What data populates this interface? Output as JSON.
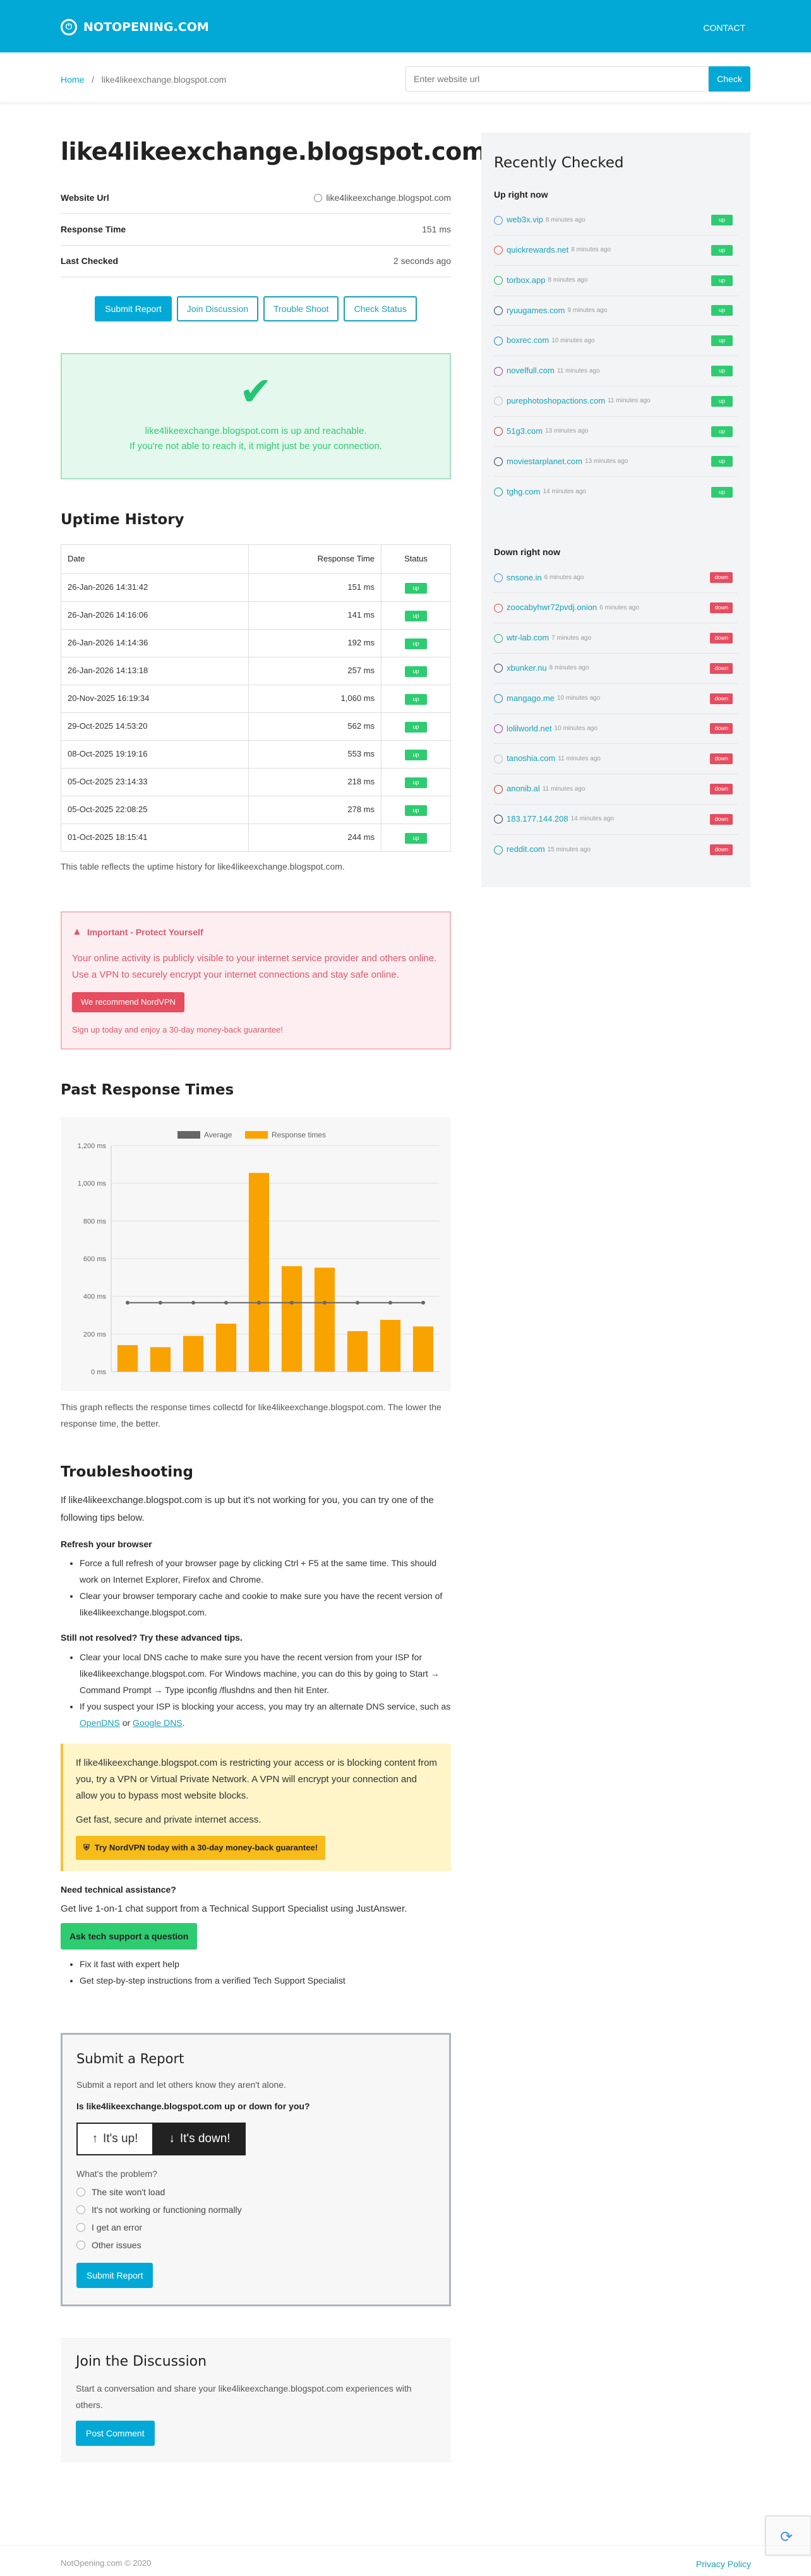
{
  "nav": {
    "brand": "NOTOPENING.COM",
    "contact": "CONTACT"
  },
  "breadcrumb": {
    "home": "Home",
    "sep": "/",
    "current": "like4likeexchange.blogspot.com"
  },
  "search": {
    "placeholder": "Enter website url",
    "button": "Check"
  },
  "main": {
    "title": "like4likeexchange.blogspot.com",
    "website_url_label": "Website Url",
    "website_url_value": "like4likeexchange.blogspot.com",
    "response_time_label": "Response Time",
    "response_time_value": "151 ms",
    "last_checked_label": "Last Checked",
    "last_checked_value": "2 seconds ago",
    "buttons": [
      "Submit Report",
      "Join Discussion",
      "Trouble Shoot",
      "Check Status"
    ],
    "status_line1": "like4likeexchange.blogspot.com is up and reachable.",
    "status_line2": "If you're not able to reach it, it might just be your connection."
  },
  "uptime": {
    "heading": "Uptime History",
    "headers": [
      "Date",
      "Response Time",
      "Status"
    ],
    "rows": [
      [
        "26-Jan-2026 14:31:42",
        "151 ms",
        "up"
      ],
      [
        "26-Jan-2026 14:16:06",
        "141 ms",
        "up"
      ],
      [
        "26-Jan-2026 14:14:36",
        "192 ms",
        "up"
      ],
      [
        "26-Jan-2026 14:13:18",
        "257 ms",
        "up"
      ],
      [
        "20-Nov-2025 16:19:34",
        "1,060 ms",
        "up"
      ],
      [
        "29-Oct-2025 14:53:20",
        "562 ms",
        "up"
      ],
      [
        "08-Oct-2025 19:19:16",
        "553 ms",
        "up"
      ],
      [
        "05-Oct-2025 23:14:33",
        "218 ms",
        "up"
      ],
      [
        "05-Oct-2025 22:08:25",
        "278 ms",
        "up"
      ],
      [
        "01-Oct-2025 18:15:41",
        "244 ms",
        "up"
      ]
    ],
    "note": "This table reflects the uptime history for like4likeexchange.blogspot.com."
  },
  "warning": {
    "title": "Important - Protect Yourself",
    "text": "Your online activity is publicly visible to your internet service provider and others online. Use a VPN to securely encrypt your internet connections and stay safe online.",
    "button": "We recommend NordVPN",
    "small": "Sign up today and enjoy a 30-day money-back guarantee!"
  },
  "chart_section": {
    "heading": "Past Response Times",
    "note": "This graph reflects the response times collectd for like4likeexchange.blogspot.com. The lower the response time, the better."
  },
  "chart_data": {
    "type": "bar",
    "legend": [
      "Average",
      "Response times"
    ],
    "legend_position": "top",
    "colors": {
      "bar": "#f9a300",
      "average": "#666666"
    },
    "ylim": [
      0,
      1200
    ],
    "yticks": [
      "0 ms",
      "200 ms",
      "400 ms",
      "600 ms",
      "800 ms",
      "1,000 ms",
      "1,200 ms"
    ],
    "ytick_values": [
      0,
      200,
      400,
      600,
      800,
      1000,
      1200
    ],
    "categories": [
      "",
      "",
      "",
      "",
      "",
      "",
      "",
      "",
      "",
      ""
    ],
    "series": [
      {
        "name": "Response times",
        "values": [
          141,
          130,
          190,
          255,
          1055,
          560,
          552,
          215,
          275,
          240
        ]
      },
      {
        "name": "Average",
        "values": [
          366,
          366,
          366,
          366,
          366,
          366,
          366,
          366,
          366,
          366
        ]
      }
    ],
    "grid": true
  },
  "troubleshoot": {
    "heading": "Troubleshooting",
    "intro": "If like4likeexchange.blogspot.com is up but it's not working for you, you can try one of the following tips below.",
    "refresh_h": "Refresh your browser",
    "refresh_1": "Force a full refresh of your browser page by clicking Ctrl + F5 at the same time. This should work on Internet Explorer, Firefox and Chrome.",
    "refresh_2": "Clear your browser temporary cache and cookie to make sure you have the recent version of like4likeexchange.blogspot.com.",
    "adv_h": "Still not resolved? Try these advanced tips.",
    "adv_1": "Clear your local DNS cache to make sure you have the recent version from your ISP for like4likeexchange.blogspot.com. For Windows machine, you can do this by going to Start → Command Prompt → Type ipconfig /flushdns and then hit Enter.",
    "adv_2a": "If you suspect your ISP is blocking your access, you may try an alternate DNS service, such as ",
    "opendns": "OpenDNS",
    "or": " or ",
    "googledns": "Google DNS",
    "dot": ".",
    "yellow_text": "If like4likeexchange.blogspot.com is restricting your access or is blocking content from you, try a VPN or Virtual Private Network. A VPN will encrypt your connection and allow you to bypass most website blocks.",
    "yellow_text2": "Get fast, secure and private internet access.",
    "yellow_btn": "Try NordVPN today with a 30-day money-back guarantee!",
    "tech_h": "Need technical assistance?",
    "tech_p": "Get live 1-on-1 chat support from a Technical Support Specialist using JustAnswer.",
    "tech_btn": "Ask tech support a question",
    "tech_1": "Fix it fast with expert help",
    "tech_2": "Get step-by-step instructions from a verified Tech Support Specialist"
  },
  "report": {
    "heading": "Submit a Report",
    "sub": "Submit a report and let others know they aren't alone.",
    "question": "Is like4likeexchange.blogspot.com up or down for you?",
    "up": "It's up!",
    "down": "It's down!",
    "problem": "What's the problem?",
    "options": [
      "The site won't load",
      "It's not working or functioning normally",
      "I get an error",
      "Other issues"
    ],
    "submit": "Submit Report"
  },
  "discussion": {
    "heading": "Join the Discussion",
    "text": "Start a conversation and share your like4likeexchange.blogspot.com experiences with others.",
    "button": "Post Comment"
  },
  "sidebar": {
    "heading": "Recently Checked",
    "up_heading": "Up right now",
    "up": [
      {
        "site": "web3x.vip",
        "time": "8 minutes ago"
      },
      {
        "site": "quickrewards.net",
        "time": "8 minutes ago"
      },
      {
        "site": "torbox.app",
        "time": "8 minutes ago"
      },
      {
        "site": "ryuugames.com",
        "time": "9 minutes ago"
      },
      {
        "site": "boxrec.com",
        "time": "10 minutes ago"
      },
      {
        "site": "novelfull.com",
        "time": "11 minutes ago"
      },
      {
        "site": "purephotoshopactions.com",
        "time": "11 minutes ago"
      },
      {
        "site": "51g3.com",
        "time": "13 minutes ago"
      },
      {
        "site": "moviestarplanet.com",
        "time": "13 minutes ago"
      },
      {
        "site": "tghg.com",
        "time": "14 minutes ago"
      }
    ],
    "down_heading": "Down right now",
    "down": [
      {
        "site": "snsone.in",
        "time": "6 minutes ago"
      },
      {
        "site": "zoocabyhwr72pvdj.onion",
        "time": "6 minutes ago"
      },
      {
        "site": "wtr-lab.com",
        "time": "7 minutes ago"
      },
      {
        "site": "xbunker.nu",
        "time": "8 minutes ago"
      },
      {
        "site": "mangago.me",
        "time": "10 minutes ago"
      },
      {
        "site": "lolilworld.net",
        "time": "10 minutes ago"
      },
      {
        "site": "tanoshia.com",
        "time": "11 minutes ago"
      },
      {
        "site": "anonib.al",
        "time": "11 minutes ago"
      },
      {
        "site": "183.177.144.208",
        "time": "14 minutes ago"
      },
      {
        "site": "reddit.com",
        "time": "15 minutes ago"
      }
    ],
    "up_label": "up",
    "down_label": "down"
  },
  "footer": {
    "copy": "NotOpening.com © 2020",
    "privacy": "Privacy Policy"
  }
}
